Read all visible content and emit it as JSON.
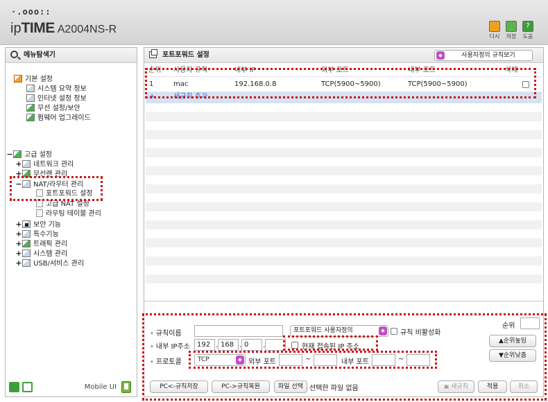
{
  "header": {
    "logo_dots": "·.ooo::",
    "brand_ip": "ip",
    "brand_time": "TIME",
    "model": "A2004NS-R",
    "buttons": [
      {
        "label": "다시",
        "icon": "refresh-icon",
        "color": "#f0a020"
      },
      {
        "label": "저장",
        "icon": "save-icon",
        "color": "#59b64a"
      },
      {
        "label": "도움",
        "icon": "help-icon",
        "color": "#3f9e3a"
      }
    ]
  },
  "nav": {
    "title": "메뉴탐색기",
    "basic": {
      "label": "기본 설정",
      "items": [
        "시스템 요약 정보",
        "인터넷 설정 정보",
        "무선 설정/보안",
        "펌웨어 업그레이드"
      ]
    },
    "advanced": {
      "label": "고급 설정",
      "items": [
        {
          "label": "네트워크 관리",
          "expander": "+"
        },
        {
          "label": "무선랜 관리",
          "expander": "+"
        },
        {
          "label": "NAT/라우터 관리",
          "expander": "−"
        },
        {
          "label": "포트포워드 설정",
          "expander": ""
        },
        {
          "label": "고급 NAT 설정",
          "expander": ""
        },
        {
          "label": "라우팅 테이블 관리",
          "expander": ""
        },
        {
          "label": "보안 기능",
          "expander": "+"
        },
        {
          "label": "특수기능",
          "expander": "+"
        },
        {
          "label": "트래픽 관리",
          "expander": "+"
        },
        {
          "label": "시스템 관리",
          "expander": "+"
        },
        {
          "label": "USB/서비스 관리",
          "expander": "+"
        }
      ],
      "expander": "−"
    },
    "footer": {
      "mobile_label": "Mobile UI"
    }
  },
  "main": {
    "title": "포트포워드 설정",
    "view_select": "사용자정의 규칙보기",
    "table": {
      "headers": [
        "순위",
        "사용자 규칙",
        "내부 IP",
        "외부 포트",
        "내부 포트",
        "삭제"
      ],
      "rows": [
        {
          "rank": "1",
          "name": "mac",
          "ip": "192.168.0.8",
          "ext_port": "TCP(5900~5900)",
          "int_port": "TCP(5900~5900)"
        }
      ],
      "add_label": "새규칙 추가",
      "add_symbol": "+"
    },
    "form": {
      "rule_name_label": "규칙이름",
      "rule_name_value": "",
      "preset_select": "포트포워드 사용자정의",
      "disable_label": "규칙 비활성화",
      "ip_label": "내부 IP주소",
      "ip_parts": [
        "192",
        "168",
        "0",
        ""
      ],
      "current_ip_label": "현재 접속된 IP 주소",
      "protocol_label": "프로토콜",
      "protocol_value": "TCP",
      "ext_port_label": "외부 포트",
      "int_port_label": "내부 포트",
      "tilde": "~",
      "rank_label": "순위",
      "rank_value": "",
      "rank_up": "▲순위높임",
      "rank_down": "▼순위낮춤",
      "backup_button": "PC<-규칙저장",
      "restore_button": "PC->규칙복원",
      "file_button": "파일 선택",
      "file_status": "선택한 파일 없음",
      "new_rule_button": "새규칙",
      "apply_button": "적용",
      "cancel_button": "취소"
    }
  },
  "colors": {
    "highlight": "#cc1111",
    "add_row_bg": "#d6e2f2",
    "select_accent": "#c04fc4"
  }
}
